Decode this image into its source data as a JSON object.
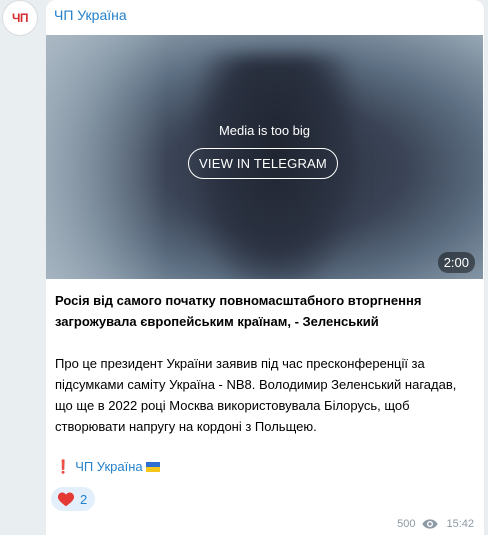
{
  "channel": {
    "avatar_text": "ЧП",
    "name": "ЧП Україна"
  },
  "media": {
    "notice": "Media is too big",
    "button_label": "VIEW IN TELEGRAM",
    "duration": "2:00"
  },
  "post": {
    "title": "Росія від самого початку повномасштабного вторгнення загрожувала європейським країнам, - Зеленський",
    "body": "Про це президент України заявив під час пресконференції за підсумками саміту Україна - NB8. Володимир Зеленський нагадав, що ще в 2022 році Москва використовувала Білорусь, щоб створювати напругу на кордоні з Польщею.",
    "signature_mark": "❗",
    "signature_link": "ЧП Україна"
  },
  "reaction": {
    "icon": "heart-icon",
    "count": "2"
  },
  "footer": {
    "views": "500",
    "time": "15:42"
  },
  "colors": {
    "accent": "#2481cc",
    "background": "#e9eef0",
    "bubble": "#ffffff",
    "brand_red": "#d32f2f"
  }
}
